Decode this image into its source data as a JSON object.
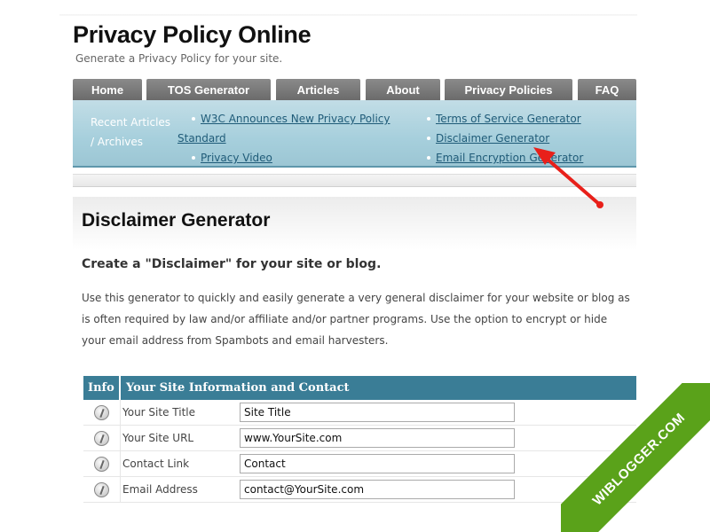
{
  "site": {
    "title": "Privacy Policy Online",
    "tagline": "Generate a Privacy Policy for your site."
  },
  "nav": {
    "tabs": [
      {
        "label": "Home"
      },
      {
        "label": "TOS Generator"
      },
      {
        "label": "Articles"
      },
      {
        "label": "About"
      },
      {
        "label": "Privacy Policies"
      },
      {
        "label": "FAQ"
      }
    ]
  },
  "subnav": {
    "recent_label_1": "Recent Articles",
    "recent_label_2": "/ Archives",
    "col1": [
      {
        "label": "W3C Announces New Privacy Policy"
      },
      {
        "label": "Standard"
      },
      {
        "label": "Privacy Video"
      }
    ],
    "col2": [
      {
        "label": "Terms of Service Generator"
      },
      {
        "label": "Disclaimer Generator"
      },
      {
        "label": "Email Encryption Generator"
      }
    ]
  },
  "main": {
    "title": "Disclaimer Generator",
    "subtitle": "Create a \"Disclaimer\" for your site or blog.",
    "intro": "Use this generator to quickly and easily generate a very general disclaimer for your website or blog as is often required by law and/or affiliate and/or partner programs. Use the option to encrypt or hide your email address from Spambots and email harvesters."
  },
  "form": {
    "header_info": "Info",
    "header_main": "Your Site Information and Contact",
    "rows": [
      {
        "label": "Your Site Title",
        "value": "Site Title"
      },
      {
        "label": "Your Site URL",
        "value": "www.YourSite.com"
      },
      {
        "label": "Contact Link",
        "value": "Contact"
      },
      {
        "label": "Email Address",
        "value": "contact@YourSite.com"
      }
    ]
  },
  "watermark": {
    "text": "WIBLOGGER.COM"
  },
  "colors": {
    "nav_tab": "#7a7a7a",
    "subnav_bg": "#a6cfdc",
    "link": "#1f5b78",
    "table_header": "#3a7d96",
    "arrow": "#e8201a",
    "ribbon": "#5aa21a"
  },
  "icons": {
    "info": "info-icon",
    "bullet": "bullet-icon"
  }
}
